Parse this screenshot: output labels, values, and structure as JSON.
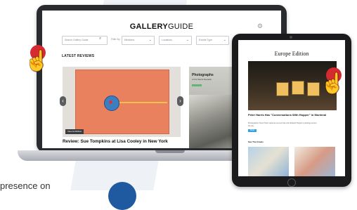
{
  "laptop": {
    "logo_bold": "GALLERY",
    "logo_light": "GUIDE",
    "filters": {
      "search_placeholder": "Search Gallery Guide",
      "filter_label": "Filter by:",
      "select1": "Mediums",
      "select2": "Locations",
      "select3": "Exhibit Type",
      "go_button": "Go"
    },
    "section_title": "LATEST REVIEWS",
    "feature_badge": "View Exhibition",
    "feature_caption": "Review: Sue Tompkins at Lisa Cooley in New York",
    "side_title": "Photographs",
    "side_subtitle": "of the Sierra Nevada"
  },
  "tablet": {
    "edition_title": "Europe Edition",
    "article_headline": "Peter Harris Has \"Conversations With Hopper\" in Montreal",
    "article_body": "Photographer Peter Harris captures scenes that echo Edward Hopper's paintings across the city.",
    "read_more": "Read More",
    "section_title": "See The Greats"
  },
  "footer": {
    "text": "presence on"
  },
  "icons": {
    "pointer": "pointing-hand-icon",
    "search": "search-icon",
    "gear": "gear-icon"
  },
  "colors": {
    "accent": "#3aa3d8",
    "pointer_red": "#d62a33",
    "footer_blue": "#1f5aa0"
  }
}
